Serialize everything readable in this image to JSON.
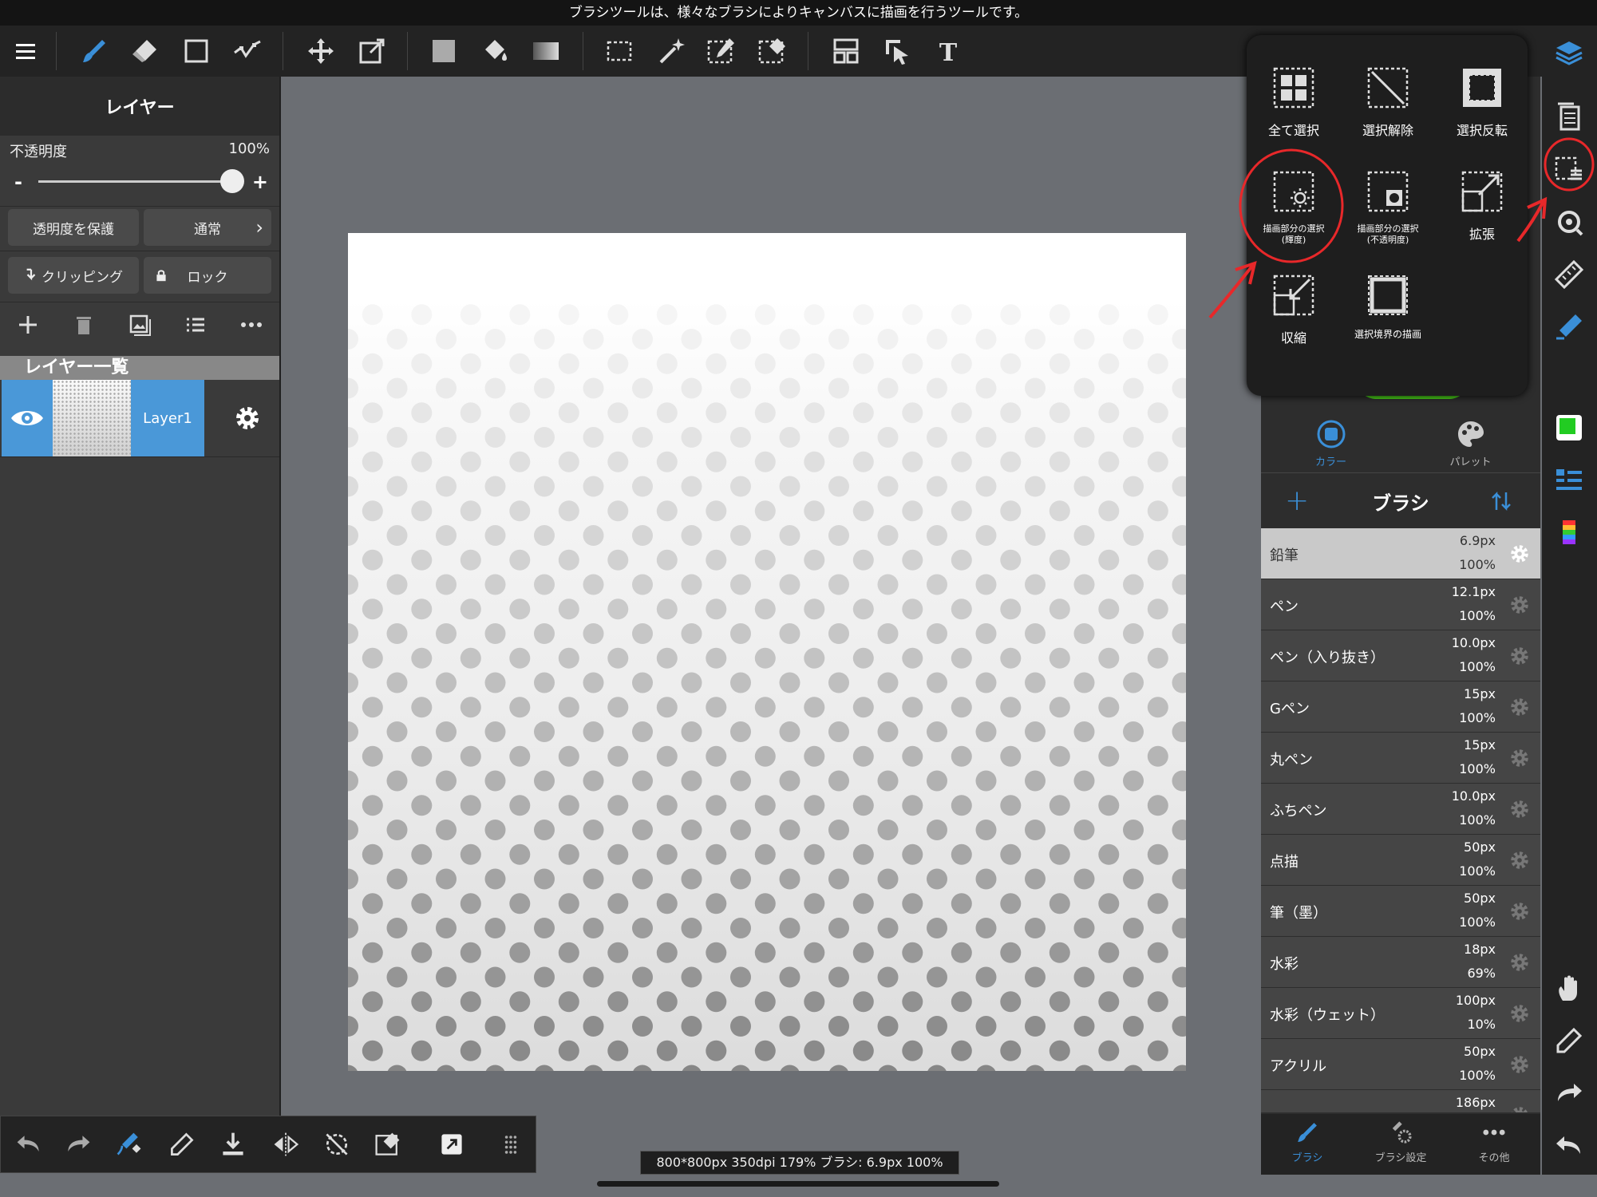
{
  "header": {
    "message": "ブラシツールは、様々なブラシによりキャンバスに描画を行うツールです。"
  },
  "toolbar": {
    "icons": [
      "menu-icon",
      "brush-icon",
      "eraser-icon",
      "shape-icon",
      "dot-icon",
      "move-icon",
      "transform-icon",
      "fill-icon",
      "bucket-icon",
      "gradient-icon",
      "select-rect-icon",
      "magic-wand-icon",
      "select-pen-icon",
      "select-eraser-icon",
      "frame-icon",
      "operation-icon",
      "text-icon"
    ]
  },
  "layer_panel": {
    "title": "レイヤー",
    "opacity_label": "不透明度",
    "opacity_value": "100%",
    "opacity_level": 1.0,
    "slider_minus": "-",
    "slider_plus": "+",
    "protect_alpha": "透明度を保護",
    "blend_mode": "通常",
    "clipping": "クリッピング",
    "lock": "ロック",
    "list_title": "レイヤー一覧",
    "layers": [
      {
        "name": "Layer1"
      }
    ]
  },
  "selection_menu": {
    "items": [
      {
        "label": "全て選択"
      },
      {
        "label": "選択解除"
      },
      {
        "label": "選択反転"
      },
      {
        "label": "描画部分の選択\n(輝度)"
      },
      {
        "label": "描画部分の選択\n(不透明度)"
      },
      {
        "label": "拡張"
      },
      {
        "label": "収縮"
      },
      {
        "label": "選択境界の描画"
      }
    ]
  },
  "color_tabs": {
    "color": "カラー",
    "palette": "パレット"
  },
  "brush_panel": {
    "title": "ブラシ",
    "add": "+",
    "brushes": [
      {
        "name": "鉛筆",
        "size": "6.9px",
        "opacity": "100%",
        "selected": true
      },
      {
        "name": "ペン",
        "size": "12.1px",
        "opacity": "100%"
      },
      {
        "name": "ペン（入り抜き）",
        "size": "10.0px",
        "opacity": "100%"
      },
      {
        "name": "Gペン",
        "size": "15px",
        "opacity": "100%"
      },
      {
        "name": "丸ペン",
        "size": "15px",
        "opacity": "100%"
      },
      {
        "name": "ふちペン",
        "size": "10.0px",
        "opacity": "100%"
      },
      {
        "name": "点描",
        "size": "50px",
        "opacity": "100%"
      },
      {
        "name": "筆（墨）",
        "size": "50px",
        "opacity": "100%"
      },
      {
        "name": "水彩",
        "size": "18px",
        "opacity": "69%"
      },
      {
        "name": "水彩（ウェット）",
        "size": "100px",
        "opacity": "10%"
      },
      {
        "name": "アクリル",
        "size": "50px",
        "opacity": "100%"
      },
      {
        "name": "",
        "size": "186px",
        "opacity": ""
      }
    ]
  },
  "bottom_nav": {
    "brush": "ブラシ",
    "brush_settings": "ブラシ設定",
    "other": "その他"
  },
  "status": {
    "text": "800*800px 350dpi 179% ブラシ: 6.9px 100%"
  },
  "colors": {
    "accent": "#4a98d8",
    "annotation": "#e8282a",
    "current_color": "#22cc22"
  }
}
